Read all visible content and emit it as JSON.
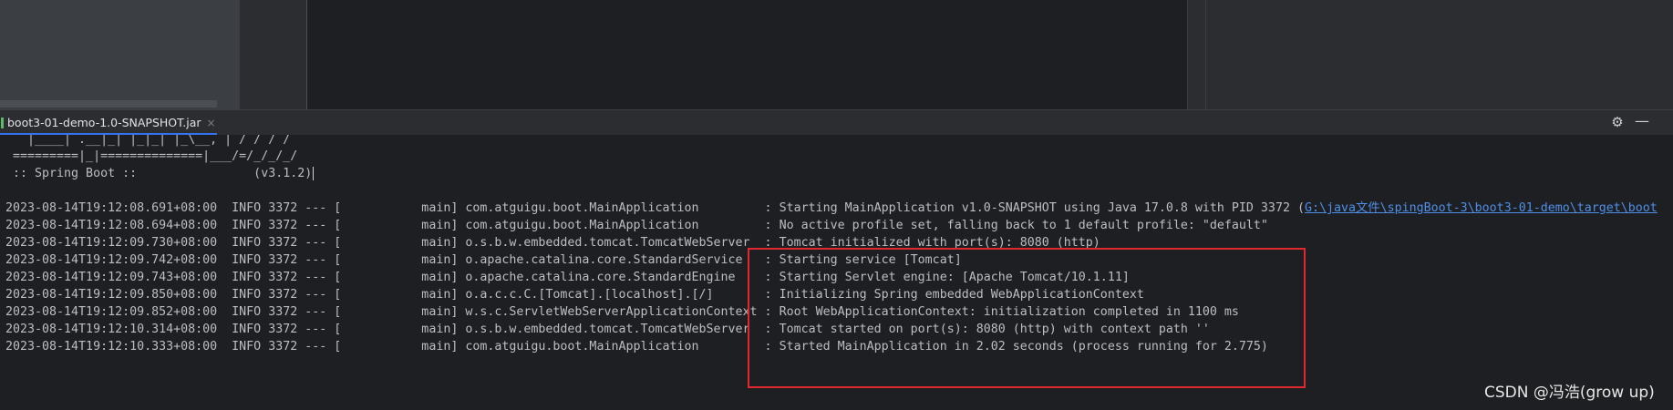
{
  "tab": {
    "label": "boot3-01-demo-1.0-SNAPSHOT.jar",
    "close": "×"
  },
  "toolbar": {
    "settings_icon": "gear-icon",
    "minimize_icon": "minimize-icon"
  },
  "colors": {
    "highlight_box": "#e0282e",
    "link": "#4e8fe8",
    "tab_accent": "#3574f0"
  },
  "console": {
    "banner": [
      "   |____| .__|_| |_|_| |_\\__, | / / / /",
      " =========|_|==============|___/=/_/_/_/",
      " :: Spring Boot ::                (v3.1.2)"
    ],
    "logs": [
      {
        "text": "2023-08-14T19:12:08.691+08:00  INFO 3372 --- [           main] com.atguigu.boot.MainApplication         : Starting MainApplication v1.0-SNAPSHOT using Java 17.0.8 with PID 3372 (",
        "link": "G:\\java文件\\spingBoot-3\\boot3-01-demo\\target\\boot"
      },
      {
        "text": "2023-08-14T19:12:08.694+08:00  INFO 3372 --- [           main] com.atguigu.boot.MainApplication         : No active profile set, falling back to 1 default profile: \"default\""
      },
      {
        "text": "2023-08-14T19:12:09.730+08:00  INFO 3372 --- [           main] o.s.b.w.embedded.tomcat.TomcatWebServer  : Tomcat initialized with port(s): 8080 (http)"
      },
      {
        "text": "2023-08-14T19:12:09.742+08:00  INFO 3372 --- [           main] o.apache.catalina.core.StandardService   : Starting service [Tomcat]"
      },
      {
        "text": "2023-08-14T19:12:09.743+08:00  INFO 3372 --- [           main] o.apache.catalina.core.StandardEngine    : Starting Servlet engine: [Apache Tomcat/10.1.11]"
      },
      {
        "text": "2023-08-14T19:12:09.850+08:00  INFO 3372 --- [           main] o.a.c.c.C.[Tomcat].[localhost].[/]       : Initializing Spring embedded WebApplicationContext"
      },
      {
        "text": "2023-08-14T19:12:09.852+08:00  INFO 3372 --- [           main] w.s.c.ServletWebServerApplicationContext : Root WebApplicationContext: initialization completed in 1100 ms"
      },
      {
        "text": "2023-08-14T19:12:10.314+08:00  INFO 3372 --- [           main] o.s.b.w.embedded.tomcat.TomcatWebServer  : Tomcat started on port(s): 8080 (http) with context path ''"
      },
      {
        "text": "2023-08-14T19:12:10.333+08:00  INFO 3372 --- [           main] com.atguigu.boot.MainApplication         : Started MainApplication in 2.02 seconds (process running for 2.775)"
      }
    ]
  },
  "watermark": "CSDN @冯浩(grow up)"
}
